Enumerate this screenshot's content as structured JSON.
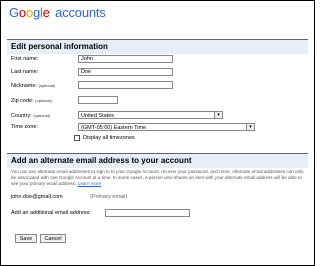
{
  "header": {
    "logo_letters": [
      "G",
      "o",
      "o",
      "g",
      "l",
      "e"
    ],
    "logo_suffix": "accounts"
  },
  "personal": {
    "title": "Edit personal information",
    "first_name": {
      "label": "First name:",
      "value": "John"
    },
    "last_name": {
      "label": "Last name:",
      "value": "Doe"
    },
    "nickname": {
      "label": "Nickname:",
      "optional": "(optional)",
      "value": ""
    },
    "zip": {
      "label": "Zip code:",
      "optional": "(optional)",
      "value": ""
    },
    "country": {
      "label": "Country:",
      "optional": "(optional)",
      "value": "United States"
    },
    "timezone": {
      "label": "Time zone:",
      "value": "(GMT-05:00) Eastern Time"
    },
    "display_all_timezones": {
      "label": "Display all timezones",
      "checked": false
    }
  },
  "alternate": {
    "title": "Add an alternate email address to your account",
    "description": "You can use alternate email addresses to sign in to your Google Account, recover your password, and more. Alternate email addresses can only be associated with one Google Account at a time. In some cases, a person who shares an item with your alternate email address will be able to see your primary email address.",
    "learn_more": "Learn more",
    "primary_email": "john.doe@gmail.com",
    "primary_tag": "(Primary email)",
    "add_label": "Add an additional email address:",
    "add_value": ""
  },
  "actions": {
    "save": "Save",
    "cancel": "Cancel"
  }
}
